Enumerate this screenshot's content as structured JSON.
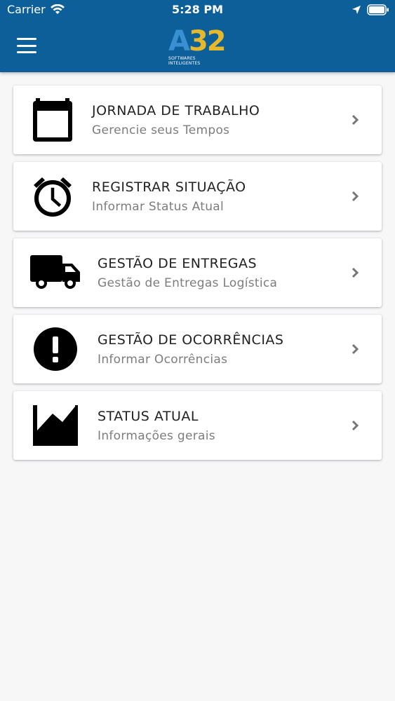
{
  "status_bar": {
    "carrier": "Carrier",
    "time": "5:28 PM"
  },
  "header": {
    "logo": {
      "mark_a": "A",
      "mark_32": "32",
      "tagline": "SOFTWARES INTELIGENTES"
    }
  },
  "menu": [
    {
      "icon": "calendar-icon",
      "title": "JORNADA DE TRABALHO",
      "subtitle": "Gerencie seus Tempos"
    },
    {
      "icon": "alarm-clock-icon",
      "title": "REGISTRAR SITUAÇÃO",
      "subtitle": "Informar Status Atual"
    },
    {
      "icon": "truck-icon",
      "title": "GESTÃO DE ENTREGAS",
      "subtitle": "Gestão de Entregas Logística"
    },
    {
      "icon": "alert-circle-icon",
      "title": "GESTÃO DE OCORRÊNCIAS",
      "subtitle": "Informar Ocorrências"
    },
    {
      "icon": "area-chart-icon",
      "title": "STATUS ATUAL",
      "subtitle": "Informações gerais"
    }
  ],
  "colors": {
    "header_bg": "#0d5f99",
    "page_bg": "#f7f7f8",
    "logo_blue": "#3a8fd3",
    "logo_gold": "#e6b82b"
  }
}
